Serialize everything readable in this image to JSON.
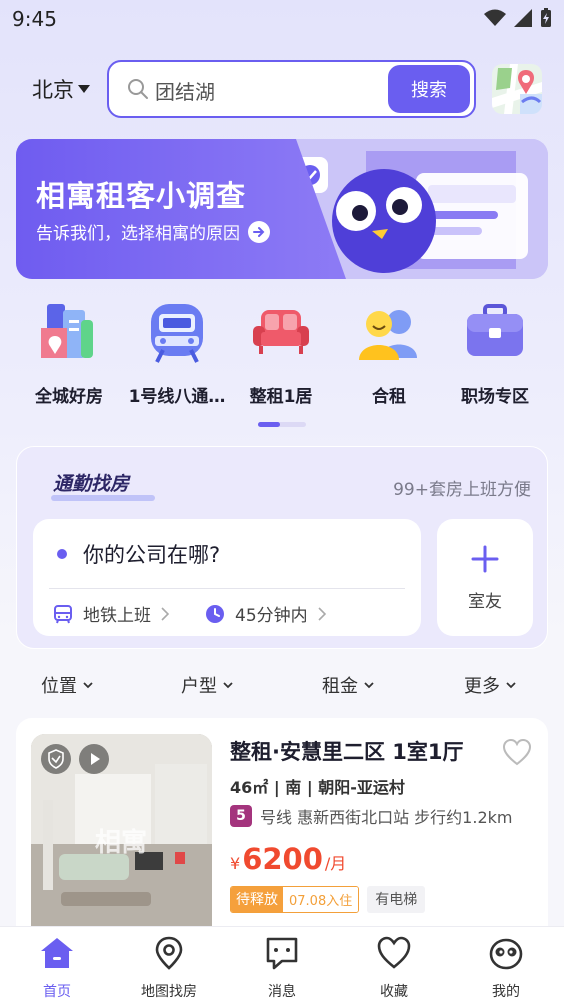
{
  "status": {
    "time": "9:45"
  },
  "search": {
    "city": "北京",
    "query": "团结湖",
    "button": "搜索"
  },
  "banner": {
    "title": "相寓租客小调查",
    "subtitle": "告诉我们，选择相寓的原因"
  },
  "categories": [
    {
      "label": "全城好房"
    },
    {
      "label": "1号线八通…"
    },
    {
      "label": "整租1居"
    },
    {
      "label": "合租"
    },
    {
      "label": "职场专区"
    }
  ],
  "commute": {
    "title": "通勤找房",
    "count": "99+套房上班方便",
    "question": "你的公司在哪?",
    "mode": "地铁上班",
    "duration": "45分钟内",
    "roommate": "室友"
  },
  "filters": [
    "位置",
    "户型",
    "租金",
    "更多"
  ],
  "listing": {
    "title": "整租·安慧里二区 1室1厅",
    "meta": "46㎡ | 南 | 朝阳-亚运村",
    "metro_line": "5",
    "metro_text": "号线 惠新西街北口站 步行约1.2km",
    "currency": "¥",
    "price": "6200",
    "unit": "/月",
    "tag_status": "待释放",
    "tag_date": "07.08入住",
    "tag_elevator": "有电梯",
    "watermark": "相寓"
  },
  "nav": [
    {
      "label": "首页"
    },
    {
      "label": "地图找房"
    },
    {
      "label": "消息"
    },
    {
      "label": "收藏"
    },
    {
      "label": "我的"
    }
  ],
  "colors": {
    "accent": "#6a5ef0",
    "price": "#f04a2f",
    "tag": "#f5a03c",
    "metro5": "#a4347d"
  }
}
